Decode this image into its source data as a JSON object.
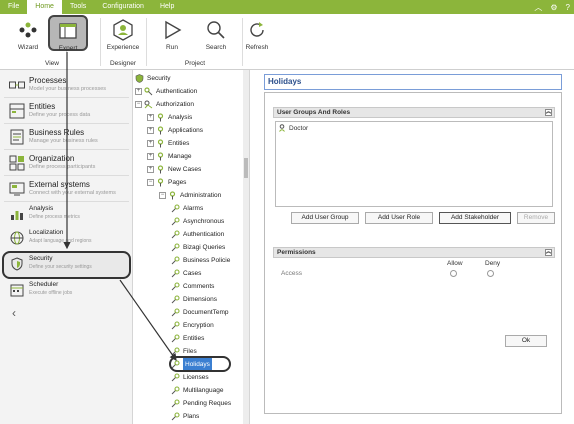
{
  "menu": {
    "items": [
      "File",
      "Home",
      "Tools",
      "Configuration",
      "Help"
    ],
    "active": "Home"
  },
  "ribbon": {
    "buttons": {
      "wizard": "Wizard",
      "expert": "Expert",
      "experience": "Experience",
      "run": "Run",
      "search": "Search",
      "refresh": "Refresh"
    },
    "groups": {
      "view": "View",
      "designer": "Designer",
      "project": "Project"
    }
  },
  "sidebar": {
    "items": [
      {
        "title": "Processes",
        "subtitle": "Model your business processes"
      },
      {
        "title": "Entities",
        "subtitle": "Define your process data"
      },
      {
        "title": "Business Rules",
        "subtitle": "Manage your business rules"
      },
      {
        "title": "Organization",
        "subtitle": "Define process participants"
      },
      {
        "title": "External systems",
        "subtitle": "Connect with your external systems"
      },
      {
        "title": "Analysis",
        "subtitle": "Define process metrics"
      },
      {
        "title": "Localization",
        "subtitle": "Adapt language and regions"
      },
      {
        "title": "Security",
        "subtitle": "Define your security settings"
      },
      {
        "title": "Scheduler",
        "subtitle": "Execute offline jobs"
      }
    ]
  },
  "tree": {
    "root": "Security",
    "nodes": [
      "Authentication",
      "Authorization",
      "Analysis",
      "Applications",
      "Entities",
      "Manage",
      "New Cases",
      "Pages",
      "Administration"
    ],
    "pages": [
      "Alarms",
      "Asynchronous",
      "Authentication",
      "Bizagi Queries",
      "Business Policie",
      "Cases",
      "Comments",
      "Dimensions",
      "DocumentTemp",
      "Encryption",
      "Entities",
      "Files",
      "Holidays",
      "Licenses",
      "Multilanguage",
      "Pending Reques",
      "Plans"
    ]
  },
  "form": {
    "title": "Holidays",
    "groups_section": "User Groups And Roles",
    "group_items": [
      "Doctor"
    ],
    "buttons": {
      "add_user_group": "Add User Group",
      "add_user_role": "Add User Role",
      "add_stakeholder": "Add Stakeholder",
      "remove": "Remove"
    },
    "permissions_section": "Permissions",
    "columns": {
      "allow": "Allow",
      "deny": "Deny"
    },
    "row_label": "Access",
    "ok": "Ok"
  },
  "colors": {
    "accent": "#8cb53b",
    "selection": "#3b7fd1",
    "header_blue": "#2b4f8b"
  }
}
